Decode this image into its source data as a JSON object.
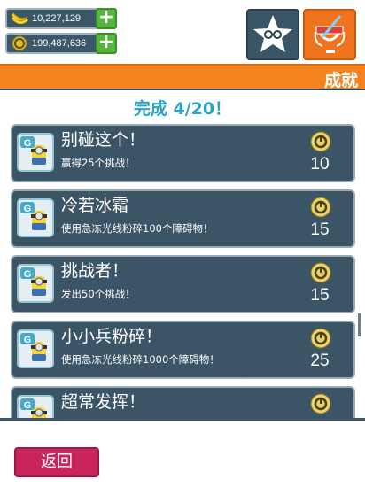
{
  "currency": {
    "bananas": "10,227,129",
    "coins": "199,487,636"
  },
  "header": {
    "title": "成就"
  },
  "achievements": {
    "progress": "完成 4/20！",
    "items": [
      {
        "name": "别碰这个！",
        "description": "赢得25个挑战！",
        "reward": "10"
      },
      {
        "name": "冷若冰霜",
        "description": "使用急冻光线粉碎100个障碍物！",
        "reward": "15"
      },
      {
        "name": "挑战者！",
        "description": "发出50个挑战！",
        "reward": "15"
      },
      {
        "name": "小小兵粉碎！",
        "description": "使用急冻光线粉碎1000个障碍物！",
        "reward": "25"
      },
      {
        "name": "超常发挥！",
        "description": "",
        "reward": ""
      }
    ]
  },
  "footer": {
    "back_label": "返回"
  },
  "colors": {
    "title_bar": "#f4821f",
    "card": "#3b5567",
    "progress_text": "#2aa5c6",
    "back_button": "#c8245e",
    "plus_button": "#55b53d"
  },
  "icons": {
    "banana": "banana-icon",
    "coin": "coin-icon",
    "plus": "plus-icon",
    "rate": "star-eyes-icon",
    "trophy": "trophy-icon",
    "badge": "minion-badge-icon"
  }
}
